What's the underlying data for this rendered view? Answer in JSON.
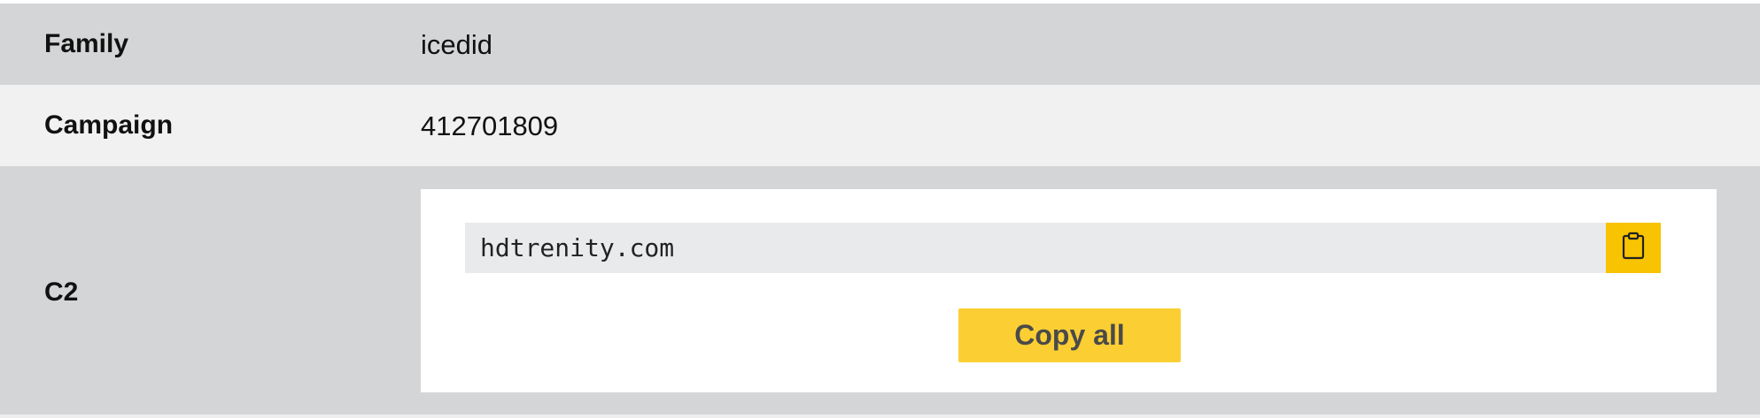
{
  "rows": {
    "family": {
      "label": "Family",
      "value": "icedid"
    },
    "campaign": {
      "label": "Campaign",
      "value": "412701809"
    },
    "c2": {
      "label": "C2",
      "entries": [
        "hdtrenity.com"
      ],
      "copy_icon": "clipboard-icon",
      "copy_all_label": "Copy all"
    }
  },
  "colors": {
    "row_dark": "#d4d5d7",
    "row_light": "#f1f1f1",
    "accent": "#fbcf33"
  }
}
